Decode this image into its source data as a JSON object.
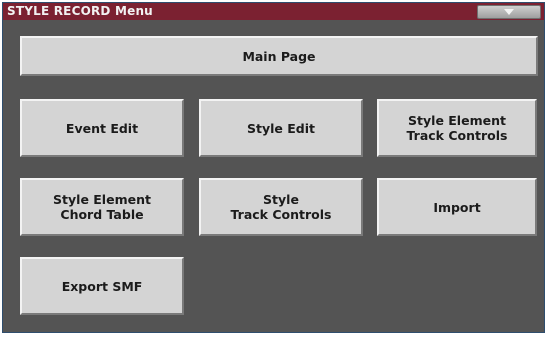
{
  "window": {
    "title": "STYLE RECORD Menu"
  },
  "header": {
    "menu_icon": "chevron-down-icon"
  },
  "buttons": {
    "main_page": "Main Page",
    "event_edit": "Event Edit",
    "style_edit": "Style Edit",
    "style_element_track_controls": "Style Element\nTrack Controls",
    "style_element_chord_table": "Style Element\nChord Table",
    "style_track_controls": "Style\nTrack Controls",
    "import": "Import",
    "export_smf": "Export SMF"
  },
  "colors": {
    "title_bar": "#7b2131",
    "background": "#545454",
    "button_face": "#d4d4d4"
  }
}
